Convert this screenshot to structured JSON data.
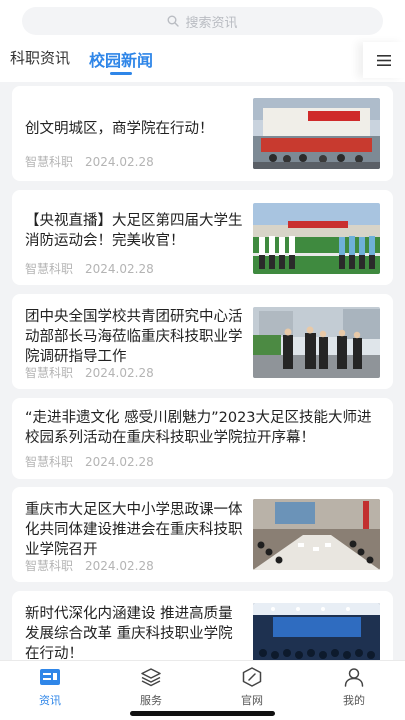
{
  "search": {
    "placeholder": "搜索资讯",
    "icon": "search-icon"
  },
  "tabs": [
    {
      "label": "科职资讯",
      "active": false
    },
    {
      "label": "校园新闻",
      "active": true
    }
  ],
  "menu_icon": "menu-icon",
  "articles": [
    {
      "title": "创文明城区，商学院在行动！",
      "source": "智慧科职",
      "date": "2024.02.28"
    },
    {
      "title": "【央视直播】大足区第四届大学生消防运动会！完美收官！",
      "source": "智慧科职",
      "date": "2024.02.28"
    },
    {
      "title": "团中央全国学校共青团研究中心活动部部长马海莅临重庆科技职业学院调研指导工作",
      "source": "智慧科职",
      "date": "2024.02.28"
    },
    {
      "title": "“走进非遗文化 感受川剧魅力”2023大足区技能大师进校园系列活动在重庆科技职业学院拉开序幕！",
      "source": "智慧科职",
      "date": "2024.02.28"
    },
    {
      "title": "重庆市大足区大中小学思政课一体化共同体建设推进会在重庆科技职业学院召开",
      "source": "智慧科职",
      "date": "2024.02.28"
    },
    {
      "title": "新时代深化内涵建设 推进高质量发展综合改革 重庆科技职业学院在行动！",
      "source": "",
      "date": ""
    }
  ],
  "nav": [
    {
      "label": "资讯",
      "icon": "news-icon",
      "active": true
    },
    {
      "label": "服务",
      "icon": "layers-icon",
      "active": false
    },
    {
      "label": "官网",
      "icon": "compass-icon",
      "active": false
    },
    {
      "label": "我的",
      "icon": "user-icon",
      "active": false
    }
  ],
  "colors": {
    "accent": "#2f86e8",
    "background": "#f2f3f5"
  }
}
